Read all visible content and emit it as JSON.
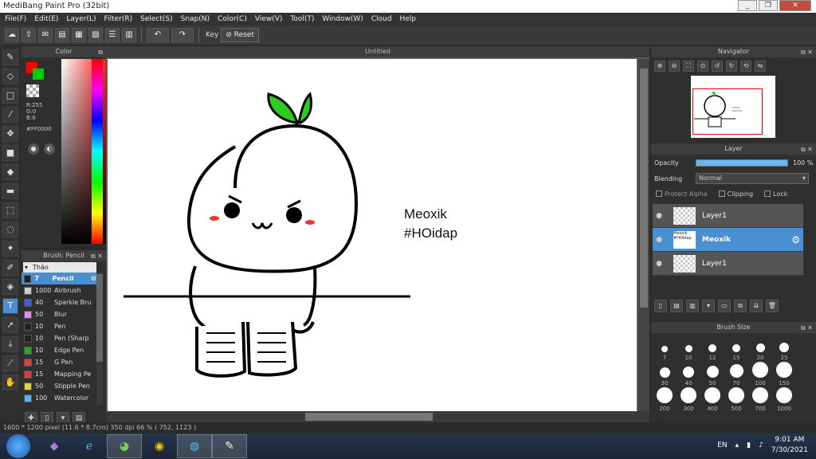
{
  "window": {
    "title": "MediBang Paint Pro (32bit)",
    "minimize": "_",
    "restore": "❐",
    "close": "✕"
  },
  "menu": [
    "File(F)",
    "Edit(E)",
    "Layer(L)",
    "Filter(R)",
    "Select(S)",
    "Snap(N)",
    "Color(C)",
    "View(V)",
    "Tool(T)",
    "Window(W)",
    "Cloud",
    "Help"
  ],
  "toolbar": {
    "key_label": "Key",
    "reset_label": "Reset"
  },
  "color_panel": {
    "title": "Color",
    "r": "R:255",
    "g": "G:0",
    "b": "B:0",
    "hex": "#FF0000"
  },
  "brush_panel": {
    "title": "Brush: Pencil",
    "folder": "Thảo",
    "items": [
      {
        "size": "7",
        "name": "Pencil",
        "color": "#222222"
      },
      {
        "size": "1000",
        "name": "Airbrush",
        "color": "#cccccc"
      },
      {
        "size": "40",
        "name": "Sparkle Bru",
        "color": "#3b5ee6"
      },
      {
        "size": "50",
        "name": "Blur",
        "color": "#e28ae6"
      },
      {
        "size": "10",
        "name": "Pen",
        "color": "#222222"
      },
      {
        "size": "10",
        "name": "Pen (Sharp",
        "color": "#222222"
      },
      {
        "size": "10",
        "name": "Edge Pen",
        "color": "#22aa22"
      },
      {
        "size": "15",
        "name": "G Pen",
        "color": "#e23b3b"
      },
      {
        "size": "15",
        "name": "Mapping Pe",
        "color": "#e23b3b"
      },
      {
        "size": "50",
        "name": "Stipple Pen",
        "color": "#e6d23b"
      },
      {
        "size": "100",
        "name": "Watercolor",
        "color": "#4ab8e6"
      }
    ]
  },
  "canvas": {
    "title": "Untitled",
    "text_line1": "Meoxik",
    "text_line2": "#HOidap"
  },
  "navigator": {
    "title": "Navigator"
  },
  "layer_panel": {
    "title": "Layer",
    "opacity_label": "Opacity",
    "opacity_value": "100 %",
    "opacity_fraction": 1.0,
    "blending_label": "Blending",
    "blending_value": "Normal",
    "protect_alpha": "Protect Alpha",
    "clipping": "Clipping",
    "lock": "Lock",
    "layers": [
      {
        "name": "Layer1",
        "selected": false,
        "thumb": ""
      },
      {
        "name": "Meoxik",
        "selected": true,
        "thumb": "Meoxik #HOidap"
      },
      {
        "name": "Layer1",
        "selected": false,
        "thumb": ""
      }
    ]
  },
  "brush_size": {
    "title": "Brush Size",
    "sizes": [
      "7",
      "10",
      "12",
      "15",
      "20",
      "25",
      "30",
      "40",
      "50",
      "70",
      "100",
      "150",
      "200",
      "300",
      "400",
      "500",
      "700",
      "1000"
    ]
  },
  "status": {
    "text": "1600 * 1200 pixel   (11.6 * 8.7cm)   350 dpi   66 %   ( 752, 1123 )"
  },
  "taskbar": {
    "lang": "EN",
    "time": "9:01 AM",
    "date": "7/30/2021"
  }
}
